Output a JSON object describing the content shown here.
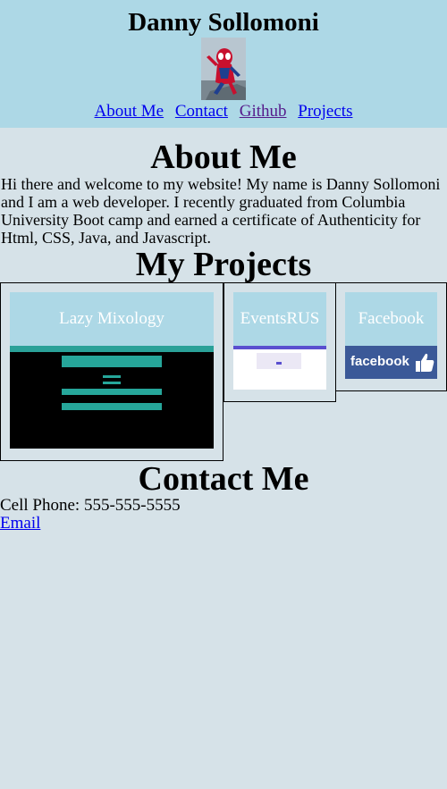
{
  "header": {
    "title": "Danny Sollomoni",
    "nav": [
      "About Me",
      "Contact",
      "Github",
      "Projects"
    ]
  },
  "about": {
    "heading": "About Me",
    "text": "Hi there and welcome to my website! My name is Danny Sollomoni and I am a web developer. I recently graduated from Columbia University Boot camp and earned a certificate of Authenticity for Html, CSS, Java, and Javascript."
  },
  "projects": {
    "heading": "My Projects",
    "items": [
      {
        "title": "Lazy Mixology"
      },
      {
        "title": "EventsRUS"
      },
      {
        "title": "Facebook",
        "logo_text": "facebook"
      }
    ]
  },
  "contact": {
    "heading": "Contact Me",
    "phone": "Cell Phone: 555-555-5555",
    "email_label": "Email"
  },
  "colors": {
    "header_bg": "#add8e6",
    "page_bg": "#d6e2e8",
    "link": "#0000ee",
    "visited_link": "#551a8b"
  }
}
